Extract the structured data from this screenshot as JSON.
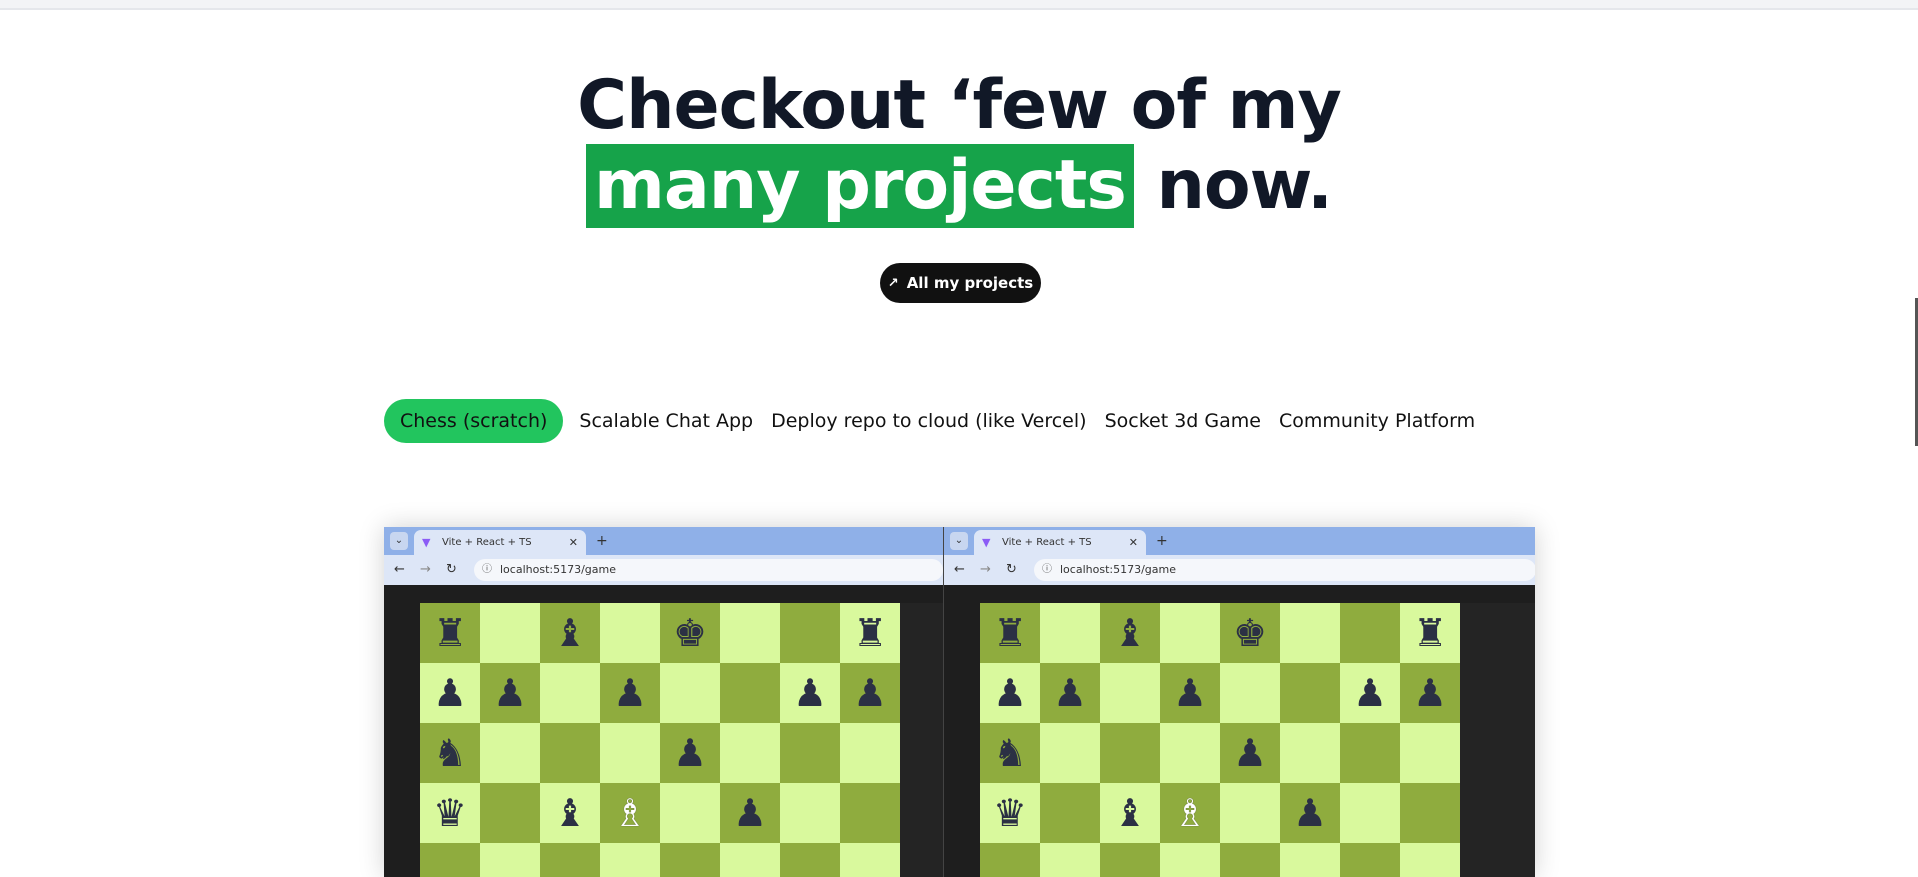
{
  "headline": {
    "line1": "Checkout ‘few of my",
    "highlight": "many projects",
    "rest": " now."
  },
  "cta": {
    "label": "All my projects",
    "icon": "arrow-up-right-icon"
  },
  "tabs": [
    {
      "label": "Chess (scratch)",
      "active": true
    },
    {
      "label": "Scalable Chat App",
      "active": false
    },
    {
      "label": "Deploy repo to cloud (like Vercel)",
      "active": false
    },
    {
      "label": "Socket 3d Game",
      "active": false
    },
    {
      "label": "Community Platform",
      "active": false
    }
  ],
  "preview": {
    "windows": [
      {
        "tab_title": "Vite + React + TS",
        "url": "localhost:5173/game"
      },
      {
        "tab_title": "Vite + React + TS",
        "url": "localhost:5173/game"
      }
    ],
    "boards": [
      {
        "rows": [
          [
            "♜",
            "",
            "♝",
            "",
            "♚",
            "",
            "",
            "♜"
          ],
          [
            "♟",
            "♟",
            "",
            "♟",
            "",
            "",
            "♟",
            "♟"
          ],
          [
            "♞",
            "",
            "",
            "",
            "♟",
            "",
            "",
            ""
          ],
          [
            "♛",
            "",
            "♝",
            "♗",
            "",
            "♟",
            "",
            ""
          ]
        ],
        "white_squares": [
          "3,3"
        ]
      },
      {
        "rows": [
          [
            "♜",
            "",
            "♝",
            "",
            "♚",
            "",
            "",
            "♜"
          ],
          [
            "♟",
            "♟",
            "",
            "♟",
            "",
            "",
            "♟",
            "♟"
          ],
          [
            "♞",
            "",
            "",
            "",
            "♟",
            "",
            "",
            ""
          ],
          [
            "♛",
            "",
            "♝",
            "♗",
            "",
            "♟",
            "",
            ""
          ]
        ],
        "white_squares": [
          "3,3"
        ]
      }
    ]
  },
  "colors": {
    "accent": "#16a34a",
    "tab_active": "#22c55e",
    "board_light": "#d9f99d",
    "board_dark": "#8fac3e"
  }
}
